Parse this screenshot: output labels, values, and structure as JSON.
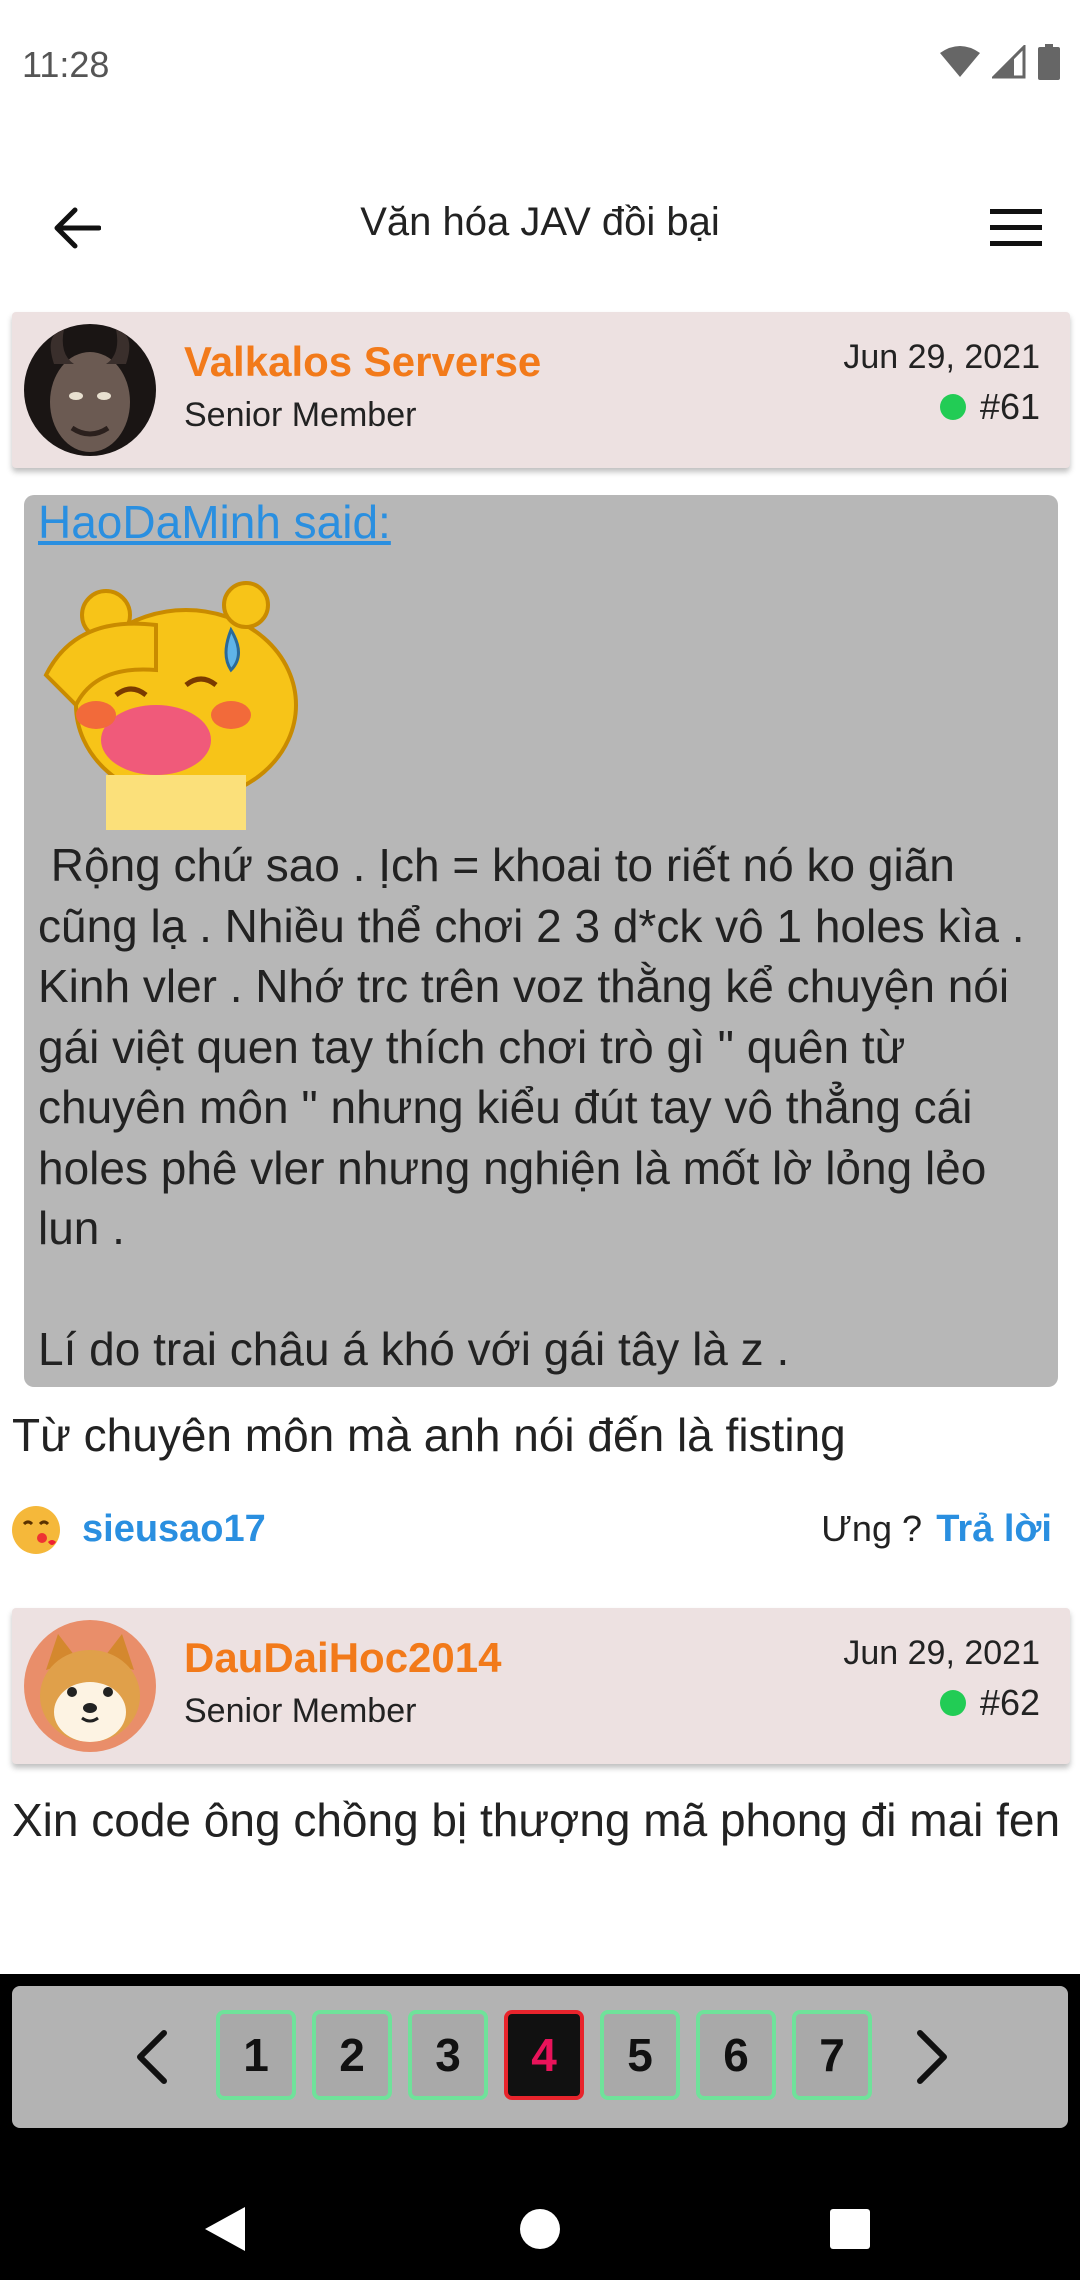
{
  "status_bar": {
    "time": "11:28",
    "icons": [
      "wifi-icon",
      "signal-icon",
      "battery-icon"
    ]
  },
  "app_bar": {
    "title": "Văn hóa JAV đồi bại",
    "back_icon": "arrow-left-icon",
    "menu_icon": "hamburger-menu-icon"
  },
  "posts": [
    {
      "author": "Valkalos Serverse",
      "role": "Senior Member",
      "date": "Jun 29, 2021",
      "number": "#61",
      "online": true,
      "quote": {
        "author_line": "HaoDaMinh said:",
        "text": " Rộng chứ sao . Ịch = khoai to riết nó ko giãn cũng lạ . Nhiều thể chơi 2 3 d*ck vô 1 holes kìa . Kinh vler . Nhớ trc trên voz thằng kể chuyện nói gái việt quen tay thích chơi trò gì \" quên từ chuyên môn \" nhưng kiểu đút tay vô thẳng cái holes phê vler nhưng nghiện là mốt lờ lỏng lẻo lun .\n\nLí do trai châu á khó với gái tây là z ."
      },
      "body": "Từ chuyên môn mà anh nói đến là fisting",
      "reaction": {
        "user": "sieusao17",
        "emoji": "kiss-face-emoji"
      },
      "react_label": "Ưng ?",
      "reply_label": "Trả lời"
    },
    {
      "author": "DauDaiHoc2014",
      "role": "Senior Member",
      "date": "Jun 29, 2021",
      "number": "#62",
      "online": true,
      "body": "Xin code ông chồng bị thượng mã phong đi mai fen"
    }
  ],
  "pagination": {
    "pages": [
      "1",
      "2",
      "3",
      "4",
      "5",
      "6",
      "7"
    ],
    "current": "4",
    "prev_icon": "chevron-left-icon",
    "next_icon": "chevron-right-icon"
  },
  "colors": {
    "username": "#f27a1a",
    "link": "#2a8fe0",
    "header_bg": "#ede1e1",
    "quote_bg": "#b7b7b7",
    "online": "#22cc55",
    "active_page": "#e8135a"
  }
}
